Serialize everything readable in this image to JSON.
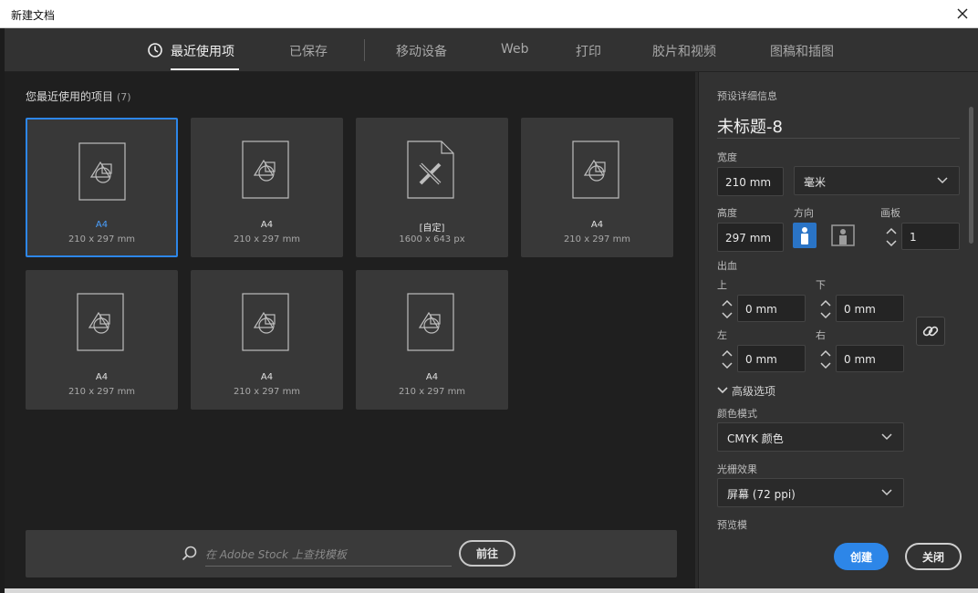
{
  "window": {
    "title": "新建文档",
    "close_icon": "close-icon"
  },
  "tabs": [
    {
      "label": "最近使用项",
      "icon": "clock-icon",
      "active": true
    },
    {
      "label": "已保存"
    },
    {
      "label": "移动设备"
    },
    {
      "label": "Web"
    },
    {
      "label": "打印"
    },
    {
      "label": "胶片和视频"
    },
    {
      "label": "图稿和插图"
    }
  ],
  "recent": {
    "title": "您最近使用的项目",
    "count": "(7)",
    "items": [
      {
        "name": "A4",
        "size": "210 x 297 mm",
        "icon": "document-shapes-icon",
        "selected": true
      },
      {
        "name": "A4",
        "size": "210 x 297 mm",
        "icon": "document-shapes-icon"
      },
      {
        "name": "[自定]",
        "size": "1600 x 643 px",
        "icon": "document-pencil-ruler-icon"
      },
      {
        "name": "A4",
        "size": "210 x 297 mm",
        "icon": "document-shapes-icon"
      },
      {
        "name": "A4",
        "size": "210 x 297 mm",
        "icon": "document-shapes-icon"
      },
      {
        "name": "A4",
        "size": "210 x 297 mm",
        "icon": "document-shapes-icon"
      },
      {
        "name": "A4",
        "size": "210 x 297 mm",
        "icon": "document-shapes-icon"
      }
    ]
  },
  "stock": {
    "placeholder": "在 Adobe Stock 上查找模板",
    "go_label": "前往"
  },
  "details": {
    "section_label": "预设详细信息",
    "doc_name": "未标题-8",
    "width_label": "宽度",
    "width_value": "210 mm",
    "unit": "毫米",
    "height_label": "高度",
    "height_value": "297 mm",
    "orientation_label": "方向",
    "artboard_label": "画板",
    "artboard_value": "1",
    "bleed_label": "出血",
    "bleed_top_label": "上",
    "bleed_top": "0 mm",
    "bleed_bottom_label": "下",
    "bleed_bottom": "0 mm",
    "bleed_left_label": "左",
    "bleed_left": "0 mm",
    "bleed_right_label": "右",
    "bleed_right": "0 mm",
    "advanced_label": "高级选项",
    "color_mode_label": "颜色模式",
    "color_mode": "CMYK 颜色",
    "raster_label": "光栅效果",
    "raster": "屏幕 (72 ppi)",
    "preview_label": "预览模",
    "create_label": "创建",
    "cancel_label": "关闭"
  },
  "colors": {
    "accent": "#2d86e8",
    "panel": "#323232",
    "main": "#1f1f1f",
    "card": "#383838"
  }
}
